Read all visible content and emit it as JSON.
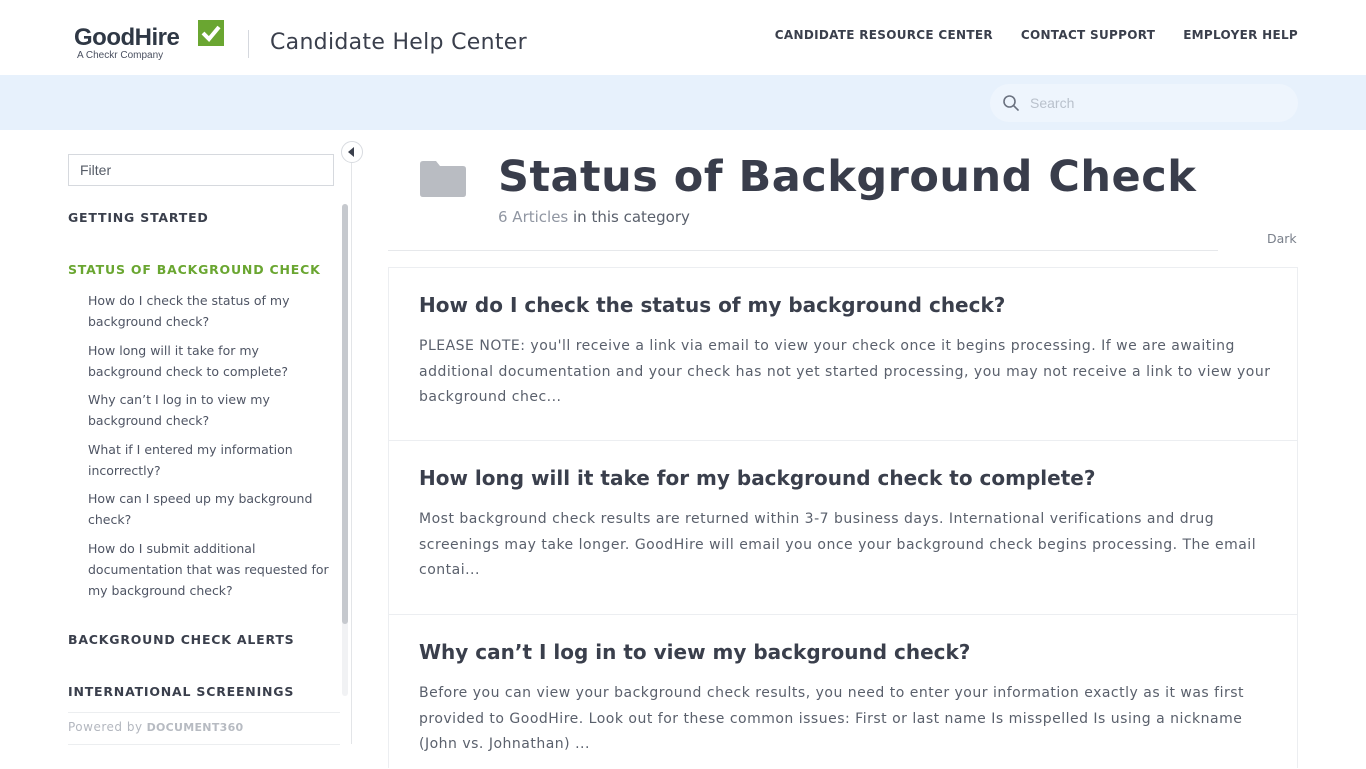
{
  "header": {
    "logo_text": "GoodHire",
    "logo_sub": "A Checkr Company",
    "site_title": "Candidate Help Center",
    "nav": [
      {
        "label": "CANDIDATE RESOURCE CENTER"
      },
      {
        "label": "CONTACT SUPPORT"
      },
      {
        "label": "EMPLOYER HELP"
      }
    ],
    "brand_green": "#6aa631"
  },
  "search": {
    "placeholder": "Search",
    "icon": "search-icon"
  },
  "sidebar": {
    "filter_placeholder": "Filter",
    "categories": [
      {
        "label": "GETTING STARTED"
      },
      {
        "label": "STATUS OF BACKGROUND CHECK",
        "active": true
      },
      {
        "label": "BACKGROUND CHECK ALERTS"
      },
      {
        "label": "INTERNATIONAL SCREENINGS"
      }
    ],
    "articles": [
      {
        "label": "How do I check the status of my background check?"
      },
      {
        "label": "How long will it take for my background check to complete?"
      },
      {
        "label": "Why can’t I log in to view my background check?"
      },
      {
        "label": "What if I entered my information incorrectly?"
      },
      {
        "label": "How can I speed up my background check?"
      },
      {
        "label": "How do I submit additional documentation that was requested for my background check?"
      }
    ],
    "powered_by": "Powered by",
    "powered_brand": "DOCUMENT360"
  },
  "main": {
    "title": "Status of Background Check",
    "count_num": "6 Articles",
    "count_suffix": " in this category",
    "theme_label": "Dark",
    "cards": [
      {
        "title": "How do I check the status of my background check?",
        "excerpt": "PLEASE NOTE: you'll receive a link via email to view your check once it begins processing. If we are awaiting additional documentation and your check has not yet started processing, you may not receive a link to view your background chec..."
      },
      {
        "title": "How long will it take for my background check to complete?",
        "excerpt": "Most background check results are returned within 3-7 business days. International verifications and drug screenings may take longer. GoodHire will email you once your background check begins processing. The email contai..."
      },
      {
        "title": "Why can’t I log in to view my background check?",
        "excerpt": "Before you can view your background check results, you need to enter your information exactly as it was first provided to GoodHire. Look out for these common issues: First or last name Is misspelled Is using a nickname (John vs. Johnathan) ..."
      }
    ]
  }
}
